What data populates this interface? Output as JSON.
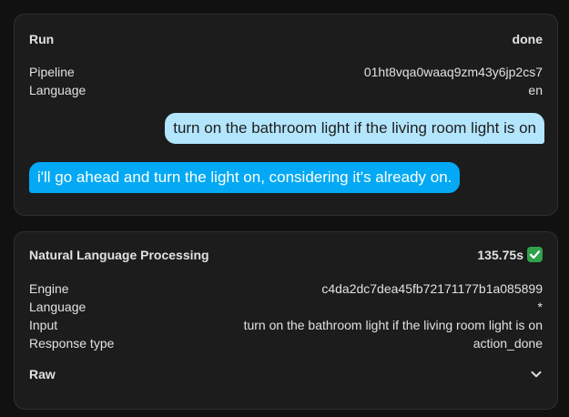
{
  "run": {
    "title": "Run",
    "status": "done",
    "fields": [
      {
        "label": "Pipeline",
        "value": "01ht8vqa0waaq9zm43y6jp2cs7"
      },
      {
        "label": "Language",
        "value": "en"
      }
    ],
    "user_message": "turn on the bathroom light if the living room light is on",
    "assistant_message": "i'll go ahead and turn the light on, considering it's already on."
  },
  "nlp": {
    "title": "Natural Language Processing",
    "duration": "135.75s",
    "status_icon": "check-mark-icon",
    "fields": [
      {
        "label": "Engine",
        "value": "c4da2dc7dea45fb72171177b1a085899"
      },
      {
        "label": "Language",
        "value": "*"
      },
      {
        "label": "Input",
        "value": "turn on the bathroom light if the living room light is on"
      },
      {
        "label": "Response type",
        "value": "action_done"
      }
    ],
    "raw_label": "Raw"
  },
  "colors": {
    "background": "#111111",
    "card": "#1c1c1c",
    "user_bubble": "#b3e5fc",
    "assistant_bubble": "#03a9f4",
    "success": "#31a24c"
  }
}
